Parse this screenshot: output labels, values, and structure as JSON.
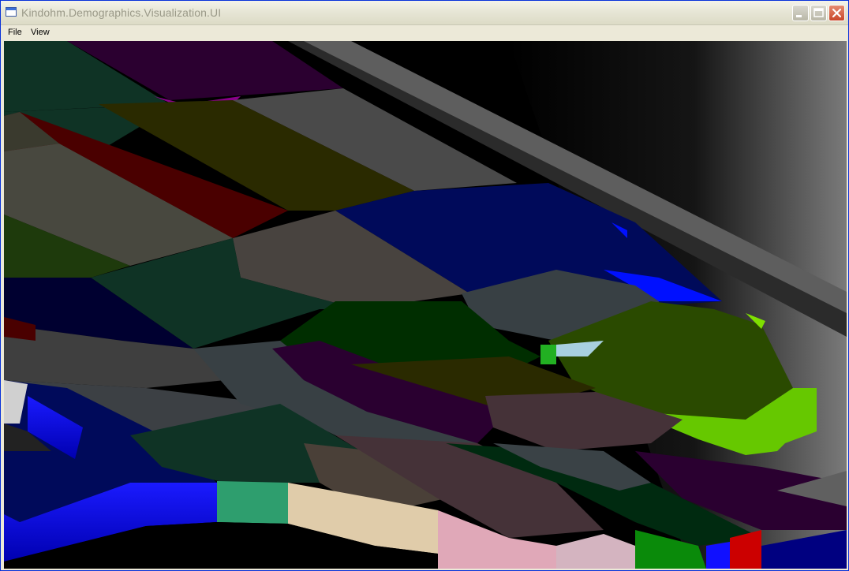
{
  "window": {
    "title": "Kindohm.Demographics.Visualization.UI",
    "controls": [
      "minimize-icon",
      "maximize-icon",
      "close-icon"
    ]
  },
  "menu": {
    "items": [
      {
        "label": "File"
      },
      {
        "label": "View"
      }
    ]
  },
  "viewport": {
    "description_icon": "3d-scene",
    "colors": {
      "background": "#000000",
      "blue": "#000a5a",
      "dark_green": "#002e00",
      "olive": "#2a2a00",
      "maroon": "#4a0000",
      "gray": "#4a4a4a",
      "slate": "#3a4246",
      "purple": "#2a0030",
      "lime": "#7fe000"
    }
  }
}
